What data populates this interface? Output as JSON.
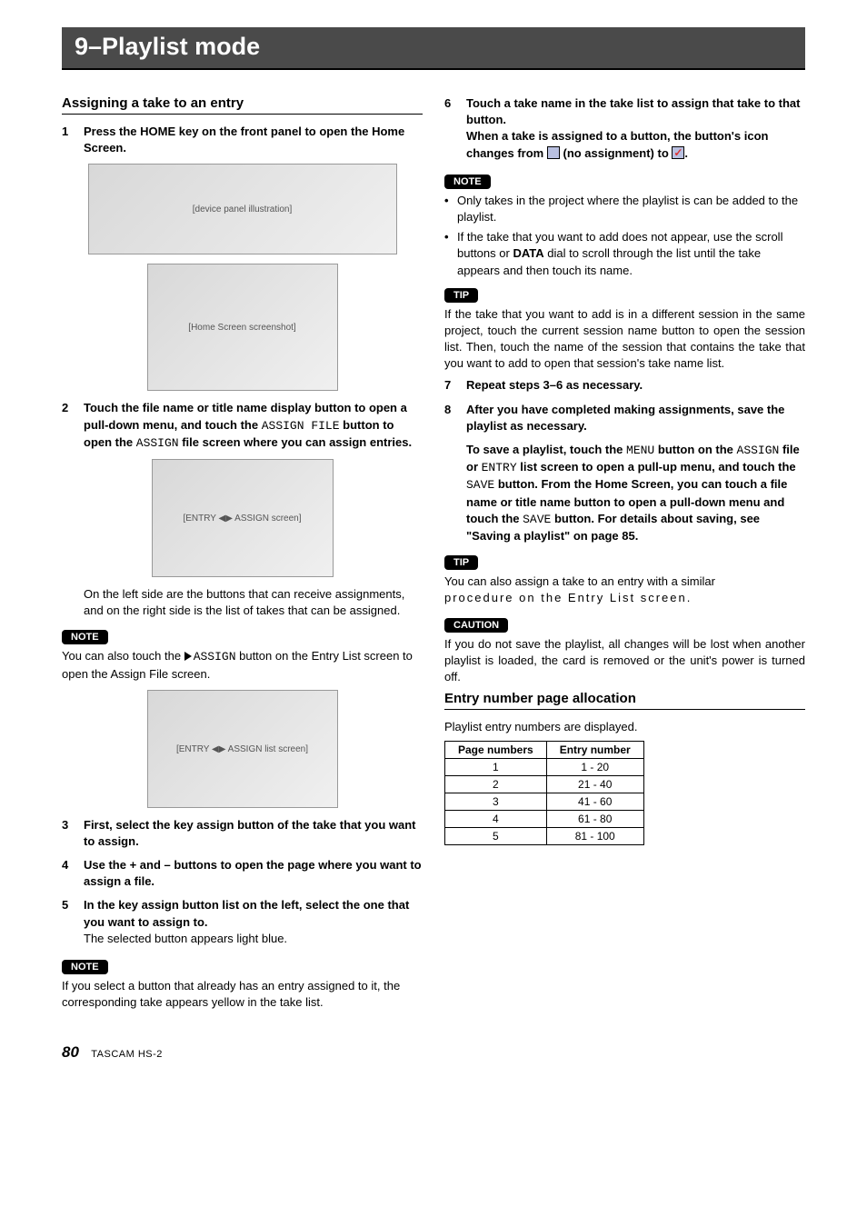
{
  "header": {
    "title": "9–Playlist mode"
  },
  "labels": {
    "note": "NOTE",
    "tip": "TIP",
    "caution": "CAUTION"
  },
  "images": {
    "device": "[device panel illustration]",
    "home": "[Home Screen screenshot]",
    "assign": "[ENTRY ◀▶ ASSIGN screen]",
    "entry": "[ENTRY ◀▶ ASSIGN list screen]"
  },
  "left": {
    "sectionTitle": "Assigning a take to an entry",
    "steps": [
      {
        "num": "1",
        "text": "Press the HOME key on the front panel to open the Home Screen."
      },
      {
        "num": "2",
        "parts": [
          "Touch the file name or title name display button to open a pull-down menu, and touch the ",
          "ASSIGN FILE",
          " button to open the ",
          "ASSIGN",
          " file screen where you can assign entries."
        ]
      },
      {
        "num": "3",
        "text": "First, select the key assign button of the take that you want to assign."
      },
      {
        "num": "4",
        "text": "Use the + and – buttons to open the page where you want to assign a file."
      },
      {
        "num": "5",
        "textBold": "In the key assign button list on the left, select the one that you want to assign to.",
        "textPlain": "The selected button appears light blue."
      }
    ],
    "afterAssignText": "On the left side are the buttons that can receive assignments, and on the right side is the list of takes that can be assigned.",
    "note1": {
      "parts": [
        "You can also touch the ",
        "ASSIGN",
        " button on the Entry List screen to open the Assign File screen."
      ]
    },
    "note2": "If you select a button that already has an entry assigned to it, the corresponding take appears yellow in the take list."
  },
  "right": {
    "steps": [
      {
        "num": "6",
        "line1": "Touch a take name in the take list to assign that take to that button.",
        "line2a": "When a take is assigned to a button, the button's icon changes from ",
        "line2b": " (no assignment) to "
      },
      {
        "num": "7",
        "text": "Repeat steps 3–6 as necessary."
      },
      {
        "num": "8",
        "text": "After you have completed making assignments, save the playlist as necessary."
      }
    ],
    "noteBullets": {
      "0": "Only takes in the project where the playlist is can be added to the playlist.",
      "1a": "If the take that you want to add does not appear, use the scroll buttons or ",
      "1b": "DATA",
      "1c": " dial to scroll through the list until the take appears and then touch its name."
    },
    "tip1": "If the take that you want to add is in a different session in the same project, touch the current session name button to open the session list. Then, touch the name of the session that contains the take that you want to add to open that session's take name list.",
    "savePara": [
      "To save a playlist, touch the ",
      "MENU",
      " button on the ",
      "ASSIGN",
      " file or ",
      "ENTRY",
      " list screen to open a pull-up menu, and touch the ",
      "SAVE",
      " button. From the Home Screen, you can touch a file name or title name button to open a pull-down menu and touch the ",
      "SAVE",
      " button. For details about saving, see \"Saving a playlist\" on page 85."
    ],
    "tip2a": "You can also assign a take to an entry with a similar",
    "tip2b": "procedure on the Entry List screen.",
    "caution": "If you do not save the playlist, all changes will be lost when another playlist is loaded, the card is removed or the unit's power is turned off.",
    "section2Title": "Entry number page allocation",
    "allocIntro": "Playlist entry numbers are displayed.",
    "table": {
      "headers": [
        "Page numbers",
        "Entry number"
      ],
      "rows": [
        [
          "1",
          "1 - 20"
        ],
        [
          "2",
          "21 - 40"
        ],
        [
          "3",
          "41 - 60"
        ],
        [
          "4",
          "61 - 80"
        ],
        [
          "5",
          "81 - 100"
        ]
      ]
    }
  },
  "footer": {
    "page": "80",
    "product": "TASCAM HS-2"
  }
}
